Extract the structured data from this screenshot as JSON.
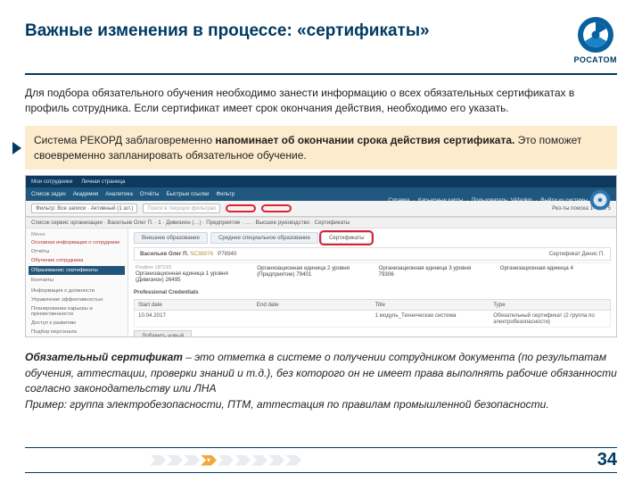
{
  "header": {
    "title": "Важные изменения в процессе: «сертификаты»",
    "brand": "РОСАТОМ"
  },
  "intro": "Для подбора обязательного обучения необходимо занести информацию о всех обязательных сертификатах в профиль сотрудника. Если сертификат имеет срок окончания действия, необходимо его указать.",
  "callout_prefix": "Система РЕКОРД заблаговременно ",
  "callout_bold": "напоминает об окончании срока действия сертификата.",
  "callout_suffix": " Это поможет своевременно запланировать обязательное обучение.",
  "app": {
    "tabs1": [
      "Мои сотрудники",
      "Личная страница"
    ],
    "tabs2": [
      "Список задач",
      "Академия",
      "Аналитика",
      "Отчёты",
      "Быстрые ссылки",
      "Фильтр"
    ],
    "tabs2_right": [
      "Справка",
      "Карьерные карты",
      "Пользователь: VAfankin",
      "Выйти из системы"
    ],
    "toolbar_filter": "Фильтр: Все записи · Активный (1 шт.)",
    "toolbar_hint": "Поиск в текущих фильтрах",
    "toolbar_result": "Рез-ты поиска  1–5 из 5",
    "breadcrumbs": "Список сервис организации · Васильев Олег П. · 1 · Дивизион (…) · Предприятие · … · Высшее руководство · Сертификаты",
    "sidebar": {
      "menu": "Меню",
      "items": [
        "Основная информация о сотруднике",
        "Отчёты",
        "Обучение сотрудника",
        "Образование; сертификаты",
        "Контакты",
        "Информация о должности",
        "Управление эффективностью",
        "Планирование карьеры и преемственности",
        "Доступ к развитию",
        "Подбор персонала"
      ]
    },
    "inner_tabs": [
      "Внешнее образование",
      "Среднее специальное образование",
      "Сертификаты"
    ],
    "employee": {
      "name": "Васильев Олег П.",
      "id": "SC38976",
      "pos": "P78940"
    },
    "levels": {
      "l1_lbl": "Position 187215",
      "l1_val": "Организационная единица 1 уровня (Дивизион) 26495",
      "l2_lbl": "",
      "l2_val": "Организационная единица 2 уровня (Предприятие) 79401",
      "l3_lbl": "Организационная единица 3 уровня 79306",
      "l4_lbl": "Организационная единица 4",
      "mgr": "Сертификат Денис П."
    },
    "cred_title": "Professional Credentials",
    "table": {
      "h1": "Start date",
      "h2": "End date",
      "h3": "Title",
      "h4": "Type",
      "r1c1": "10.04.2017",
      "r1c2": "",
      "r1c3": "1 модуль_Техническая система",
      "r1c4": "Обязательный сертификат (2 группа по электробезопасности)"
    },
    "add": "Добавить новый"
  },
  "definition_lead": "Обязательный сертификат",
  "definition_body": " – это отметка в системе о получении сотрудником документа (по результатам обучения, аттестации, проверки знаний и т.д.), без которого он не имеет права выполнять рабочие обязанности согласно законодательству или ЛНА",
  "definition_example": "Пример: группа электробезопасности, ПТМ, аттестация по правилам промышленной безопасности.",
  "page": "34"
}
